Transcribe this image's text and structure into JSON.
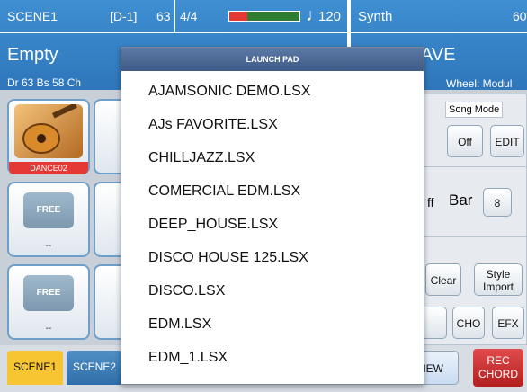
{
  "header_left": {
    "scene_label": "SCENE1",
    "drum_set_label": "[D-1]",
    "drum_number": "63",
    "time_signature": "4/4",
    "tempo": "120",
    "project_name": "Empty",
    "drum_bass_info": "Dr 63  Bs 58  Ch"
  },
  "header_right": {
    "voice_name": "Synth",
    "voice_number": "60",
    "voice_subtitle": "AVE",
    "wheel_label": "Wheel: Modul"
  },
  "pads": [
    {
      "label": "DANCE02",
      "tile": ""
    },
    {
      "label": "--",
      "tile": "FREE"
    },
    {
      "label": "--",
      "tile": "FREE"
    }
  ],
  "right_panel": {
    "song_mode_label": "Song Mode",
    "off_button": "Off",
    "edit_button": "EDIT",
    "ff_fragment": "ff",
    "bar_label": "Bar",
    "bar_value": "8",
    "clear_button": "Clear",
    "style_import_line1": "Style",
    "style_import_line2": "Import",
    "cho_button": "CHO",
    "efx_button": "EFX",
    "new_button": "NEW",
    "rec_chord_line1": "REC",
    "rec_chord_line2": "CHORD"
  },
  "bottom_tabs": {
    "scene1": "SCENE1",
    "scene2": "SCENE2"
  },
  "launch_pad": {
    "title": "LAUNCH PAD",
    "items": [
      "AJAMSONIC DEMO.LSX",
      "AJs FAVORITE.LSX",
      "CHILLJAZZ.LSX",
      "COMERCIAL EDM.LSX",
      "DEEP_HOUSE.LSX",
      "DISCO HOUSE 125.LSX",
      "DISCO.LSX",
      "EDM.LSX",
      "EDM_1.LSX"
    ]
  },
  "colors": {
    "header_blue": "#3a86c8",
    "dialog_title": "#3f5b86",
    "rec_red": "#c62828",
    "scene_yellow": "#f7c531"
  }
}
